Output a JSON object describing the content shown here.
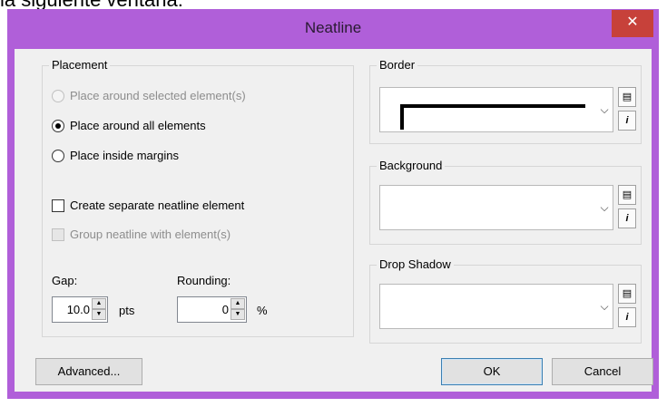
{
  "background_caption": "la siguiente ventana:",
  "window": {
    "title": "Neatline",
    "close_symbol": "✕"
  },
  "placement": {
    "legend": "Placement",
    "options": [
      {
        "label": "Place around selected element(s)",
        "checked": false,
        "disabled": true
      },
      {
        "label": "Place around all elements",
        "checked": true,
        "disabled": false
      },
      {
        "label": "Place inside margins",
        "checked": false,
        "disabled": false
      }
    ],
    "checkboxes": [
      {
        "label": "Create separate neatline element",
        "checked": false,
        "disabled": false
      },
      {
        "label": "Group neatline with element(s)",
        "checked": false,
        "disabled": true
      }
    ],
    "gap": {
      "label": "Gap:",
      "value": "10.0",
      "unit": "pts"
    },
    "rounding": {
      "label": "Rounding:",
      "value": "0",
      "unit": "%"
    }
  },
  "border": {
    "legend": "Border"
  },
  "background": {
    "legend": "Background"
  },
  "drop_shadow": {
    "legend": "Drop Shadow"
  },
  "buttons": {
    "advanced": "Advanced...",
    "ok": "OK",
    "cancel": "Cancel"
  },
  "icons": {
    "dropdown": "chevron-down-icon",
    "properties": "properties-icon",
    "info": "info-icon"
  }
}
